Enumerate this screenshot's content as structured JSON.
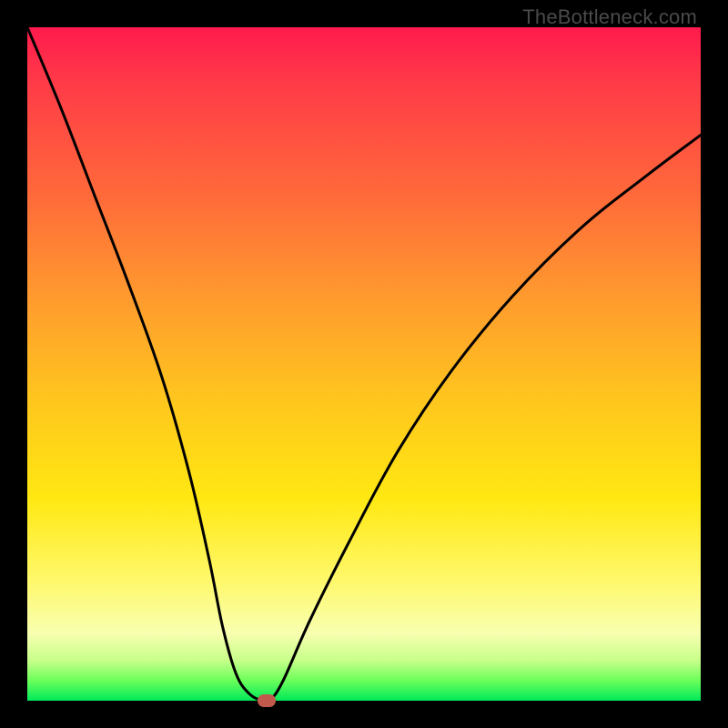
{
  "attribution": "TheBottleneck.com",
  "colors": {
    "frame": "#000000",
    "curve_stroke": "#000000",
    "marker_fill": "#c15a4d"
  },
  "chart_data": {
    "type": "line",
    "title": "",
    "xlabel": "",
    "ylabel": "",
    "xlim": [
      0,
      100
    ],
    "ylim": [
      0,
      100
    ],
    "grid": false,
    "legend": false,
    "series": [
      {
        "name": "bottleneck-curve",
        "x": [
          0,
          5,
          10,
          15,
          20,
          24,
          27,
          29,
          31,
          33,
          35,
          36,
          38,
          42,
          48,
          55,
          63,
          72,
          82,
          92,
          100
        ],
        "values": [
          100,
          88,
          75,
          62,
          48,
          34,
          21,
          11,
          4,
          1,
          0,
          0,
          3,
          12,
          24,
          37,
          49,
          60,
          70,
          78,
          84
        ]
      }
    ],
    "marker": {
      "x": 35.5,
      "y": 0
    },
    "gradient_stops": [
      {
        "pct": 0,
        "color": "#ff1a4d"
      },
      {
        "pct": 25,
        "color": "#ff6a3a"
      },
      {
        "pct": 55,
        "color": "#ffc51e"
      },
      {
        "pct": 82,
        "color": "#fff86a"
      },
      {
        "pct": 97,
        "color": "#6cff5a"
      },
      {
        "pct": 100,
        "color": "#00e85a"
      }
    ]
  }
}
